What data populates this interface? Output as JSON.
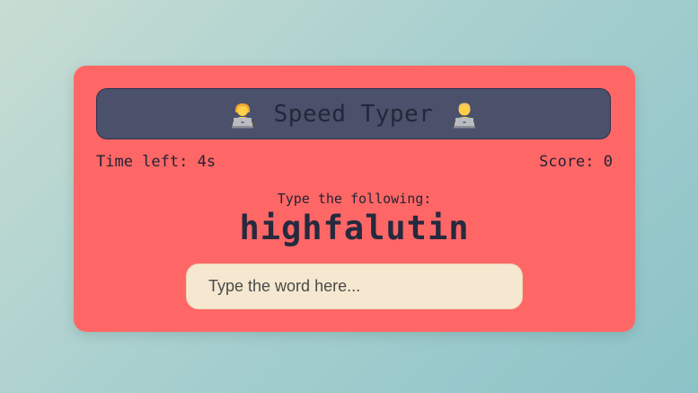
{
  "header": {
    "title": "Speed Typer",
    "left_icon": "woman-technologist-icon",
    "right_icon": "man-technologist-icon"
  },
  "stats": {
    "time_left": "Time left: 4s",
    "score": "Score: 0"
  },
  "prompt": {
    "label": "Type the following:",
    "word": "highfalutin"
  },
  "input": {
    "value": "",
    "placeholder": "Type the word here..."
  },
  "colors": {
    "background_start": "#c8ddd3",
    "background_end": "#8cc3c8",
    "card": "#ff6766",
    "header": "#4b506b",
    "input": "#f6e8d0",
    "text": "#252a3e"
  }
}
